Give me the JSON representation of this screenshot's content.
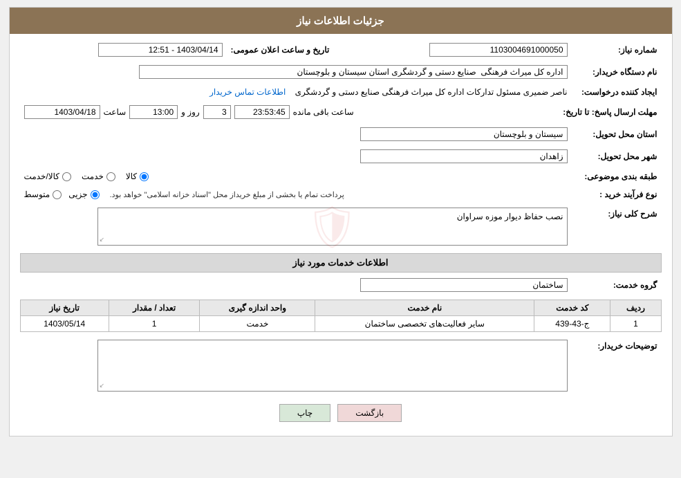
{
  "header": {
    "title": "جزئیات اطلاعات نیاز"
  },
  "fields": {
    "need_number_label": "شماره نیاز:",
    "need_number_value": "1103004691000050",
    "date_label": "تاریخ و ساعت اعلان عمومی:",
    "date_value": "1403/04/14 - 12:51",
    "buyer_org_label": "نام دستگاه خریدار:",
    "buyer_org_value": "اداره کل میراث فرهنگی  صنایع دستی و گردشگری استان سیستان و بلوچستان",
    "creator_label": "ایجاد کننده درخواست:",
    "creator_value": "ناصر ضمیری مسئول تدارکات اداره کل میراث فرهنگی  صنایع دستی و گردشگری",
    "contact_link": "اطلاعات تماس خریدار",
    "deadline_label": "مهلت ارسال پاسخ: تا تاریخ:",
    "deadline_date": "1403/04/18",
    "deadline_time_label": "ساعت",
    "deadline_time_value": "13:00",
    "days_label": "روز و",
    "days_value": "3",
    "remaining_label": "ساعت باقی مانده",
    "remaining_time": "23:53:45",
    "province_label": "استان محل تحویل:",
    "province_value": "سیستان و بلوچستان",
    "city_label": "شهر محل تحویل:",
    "city_value": "زاهدان",
    "category_label": "طبقه بندی موضوعی:",
    "category_options": [
      "کالا",
      "خدمت",
      "کالا/خدمت"
    ],
    "category_selected": "کالا",
    "purchase_type_label": "نوع فرآیند خرید :",
    "purchase_options": [
      "جزیی",
      "متوسط"
    ],
    "purchase_note": "پرداخت تمام یا بخشی از مبلغ خریداز محل \"اسناد خزانه اسلامی\" خواهد بود.",
    "description_label": "شرح کلی نیاز:",
    "description_value": "نصب حفاظ دیوار موزه سراوان",
    "services_header": "اطلاعات خدمات مورد نیاز",
    "service_group_label": "گروه خدمت:",
    "service_group_value": "ساختمان",
    "table": {
      "columns": [
        "ردیف",
        "کد خدمت",
        "نام خدمت",
        "واحد اندازه گیری",
        "تعداد / مقدار",
        "تاریخ نیاز"
      ],
      "rows": [
        {
          "row_num": "1",
          "service_code": "ج-43-439",
          "service_name": "سایر فعالیت‌های تخصصی ساختمان",
          "unit": "خدمت",
          "qty": "1",
          "date": "1403/05/14"
        }
      ]
    },
    "buyer_desc_label": "توضیحات خریدار:",
    "buyer_desc_value": ""
  },
  "buttons": {
    "print": "چاپ",
    "back": "بازگشت"
  }
}
